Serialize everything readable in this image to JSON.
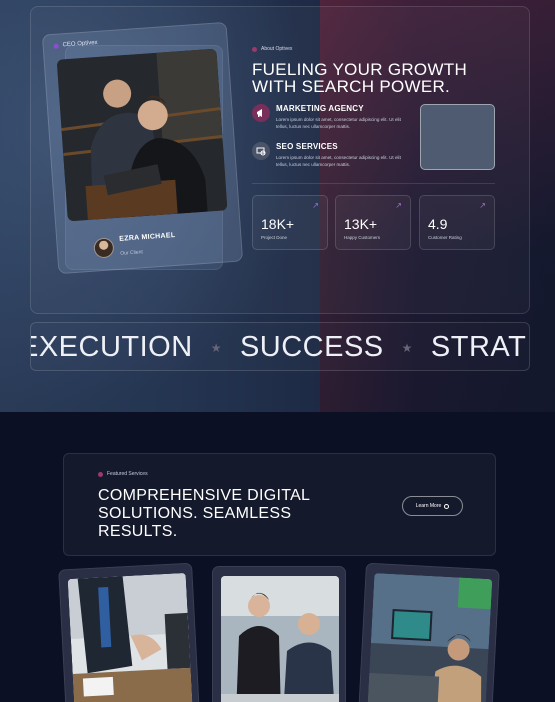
{
  "hero": {
    "card": {
      "tag": "CEO Optivex",
      "client_name": "EZRA MICHAEL",
      "client_role": "Our Client"
    },
    "about_tag": "About Optivex",
    "headline": "FUELING YOUR GROWTH WITH SEARCH POWER.",
    "services": [
      {
        "title": "MARKETING AGENCY",
        "desc": "Lorem ipsum dolor sit amet, consectetur adipiscing elit. Ut elit tellus, luctus nec ullamcorper mattis.",
        "icon": "megaphone-icon",
        "color": "#7a2e5a"
      },
      {
        "title": "SEO SERVICES",
        "desc": "Lorem ipsum dolor sit amet, consectetur adipiscing elit. Ut elit tellus, luctus nec ullamcorper mattis.",
        "icon": "seo-icon",
        "color": "#4a5368"
      }
    ],
    "stats": [
      {
        "value": "18K+",
        "label": "Project Done"
      },
      {
        "value": "13K+",
        "label": "Happy Customers"
      },
      {
        "value": "4.9",
        "label": "Customer Rating"
      }
    ]
  },
  "marquee": {
    "words": [
      "EXECUTION",
      "SUCCESS",
      "STRAT"
    ],
    "separator": "★"
  },
  "featured": {
    "tag": "Featured Services",
    "headline": "COMPREHENSIVE DIGITAL SOLUTIONS. SEAMLESS RESULTS.",
    "button_label": "Learn More"
  },
  "colors": {
    "accent": "#8a4fd1",
    "background": "#0c1024"
  }
}
